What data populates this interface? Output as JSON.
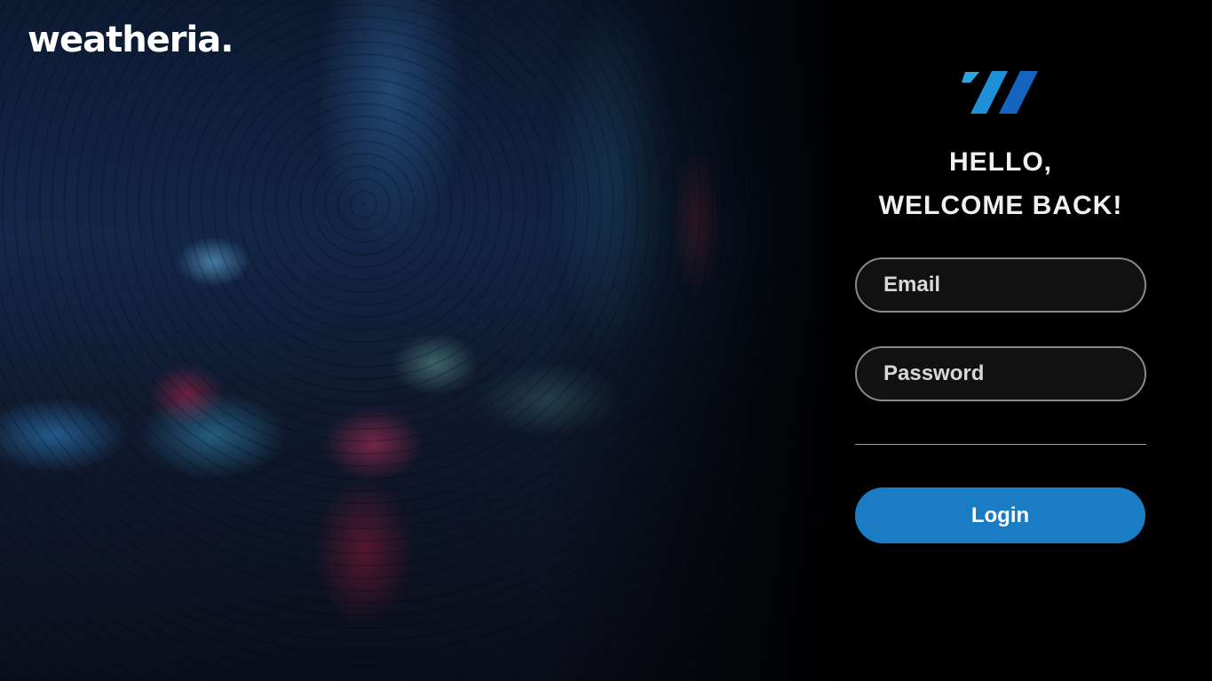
{
  "brand": {
    "name": "weatheria."
  },
  "login_panel": {
    "logo_icon": "weatheria-slashes-logo-icon",
    "greeting_line1": "HELLO,",
    "greeting_line2": "WELCOME BACK!",
    "email": {
      "placeholder": "Email",
      "value": ""
    },
    "password": {
      "placeholder": "Password",
      "value": ""
    },
    "login_label": "Login"
  },
  "colors": {
    "accent": "#1a7cc2",
    "logo_light": "#29a8e0",
    "logo_dark": "#1565c0",
    "panel_background": "#000000"
  }
}
